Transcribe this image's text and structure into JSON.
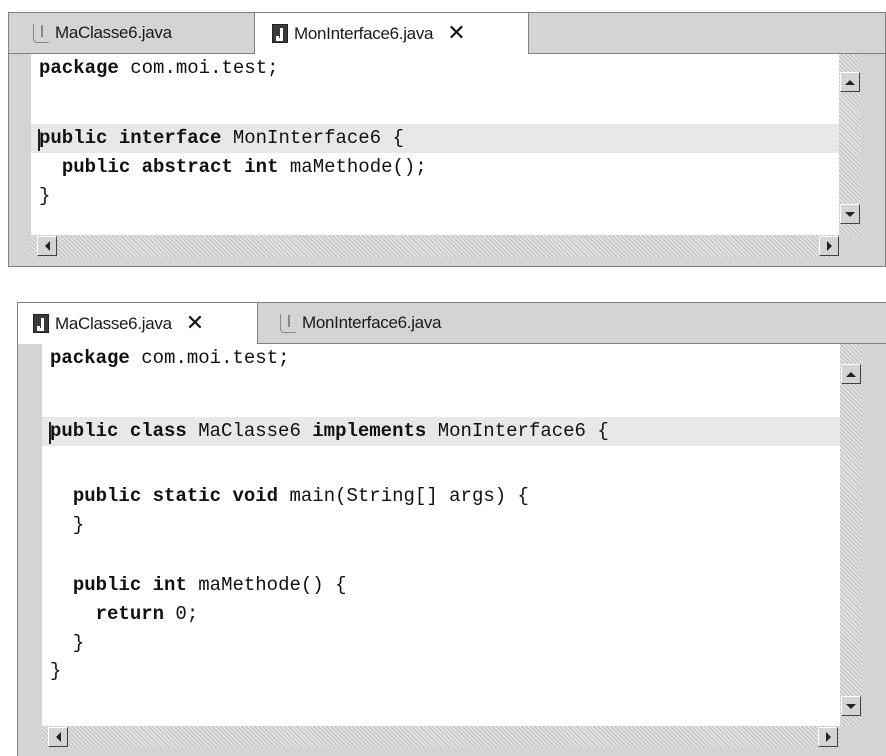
{
  "editor_top": {
    "tabs": [
      {
        "label": "MaClasse6.java",
        "active": false,
        "icon": "java-file-icon"
      },
      {
        "label": "MonInterface6.java",
        "active": true,
        "icon": "java-file-icon",
        "close": "✕"
      }
    ],
    "lines": [
      "package com.moi.test;",
      "",
      "public interface MonInterface6 {",
      "  public abstract int maMethode();",
      "}"
    ],
    "current_line": 3
  },
  "editor_bottom": {
    "tabs": [
      {
        "label": "MaClasse6.java",
        "active": true,
        "icon": "java-file-icon",
        "close": "✕"
      },
      {
        "label": "MonInterface6.java",
        "active": false,
        "icon": "java-file-icon"
      }
    ],
    "lines": [
      "package com.moi.test;",
      "",
      "public class MaClasse6 implements MonInterface6 {",
      "",
      "  public static void main(String[] args) {",
      "  }",
      "",
      "  public int maMethode() {",
      "    return 0;",
      "  }",
      "}"
    ],
    "current_line": 3
  },
  "keywords": [
    "package",
    "public",
    "interface",
    "abstract",
    "int",
    "class",
    "implements",
    "static",
    "void",
    "return"
  ],
  "colors": {
    "chrome": "#d4d4d4",
    "editor_bg": "#ffffff",
    "current_line": "#e8e8e8",
    "text": "#111111"
  }
}
